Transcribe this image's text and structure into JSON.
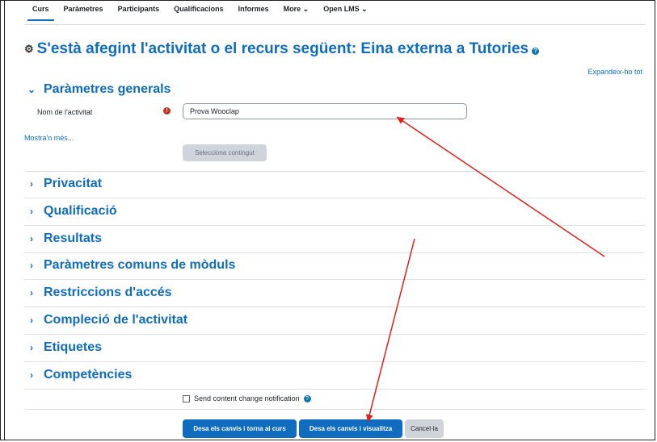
{
  "nav": {
    "tabs": [
      "Curs",
      "Paràmetres",
      "Participants",
      "Qualificacions",
      "Informes",
      "More ⌄",
      "Open LMS ⌄"
    ],
    "active": "Curs"
  },
  "page": {
    "title": "S'està afegint l'activitat o el recurs següent: Eina externa a Tutories",
    "module_icon": "puzzle-icon",
    "expand_all": "Expandeix-ho tot"
  },
  "general": {
    "heading": "Paràmetres generals",
    "name_label": "Nom de l'activitat",
    "name_value": "Prova Wooclap",
    "show_more": "Mostra'n més...",
    "select_content": "Selecciona contingut"
  },
  "sections": [
    "Privacitat",
    "Qualificació",
    "Resultats",
    "Paràmetres comuns de mòduls",
    "Restriccions d'accés",
    "Compleció de l'activitat",
    "Etiquetes",
    "Competències"
  ],
  "footer": {
    "notify_label": "Send content change notification",
    "save_return": "Desa els canvis i torna al curs",
    "save_display": "Desa els canvis i visualitza",
    "cancel": "Cancel·la"
  },
  "colors": {
    "link": "#0f6cbf",
    "primary_button": "#0f6cbf",
    "annotation_arrow": "#e0201a",
    "required": "#ca3120"
  }
}
